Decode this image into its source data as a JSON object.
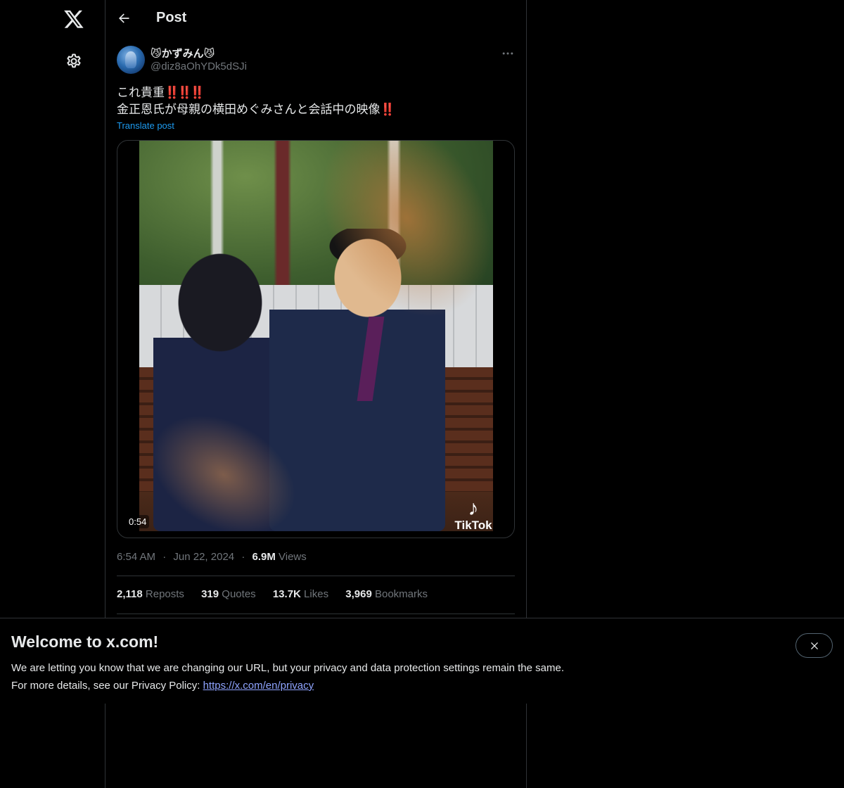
{
  "header": {
    "title": "Post"
  },
  "nav": {
    "logo": "x-logo",
    "settings_icon": "gear-icon"
  },
  "post": {
    "author_name": "😼かずみん😼",
    "author_handle": "@diz8aOhYDk5dSJi",
    "text_line1": "これ貴重",
    "text_line1_marks": "‼️‼️‼️",
    "text_line2": "金正恩氏が母親の横田めぐみさんと会話中の映像",
    "text_line2_mark": "‼️",
    "translate_label": "Translate post",
    "video_duration": "0:54",
    "watermark": "TikTok",
    "time": "6:54 AM",
    "date": "Jun 22, 2024",
    "views_count": "6.9M",
    "views_label": "Views"
  },
  "stats": [
    {
      "count": "2,118",
      "label": "Reposts"
    },
    {
      "count": "319",
      "label": "Quotes"
    },
    {
      "count": "13.7K",
      "label": "Likes"
    },
    {
      "count": "3,969",
      "label": "Bookmarks"
    }
  ],
  "banner": {
    "title": "Welcome to x.com!",
    "line1": "We are letting you know that we are changing our URL, but your privacy and data protection settings remain the same.",
    "line2_prefix": "For more details, see our Privacy Policy: ",
    "link": "https://x.com/en/privacy"
  }
}
